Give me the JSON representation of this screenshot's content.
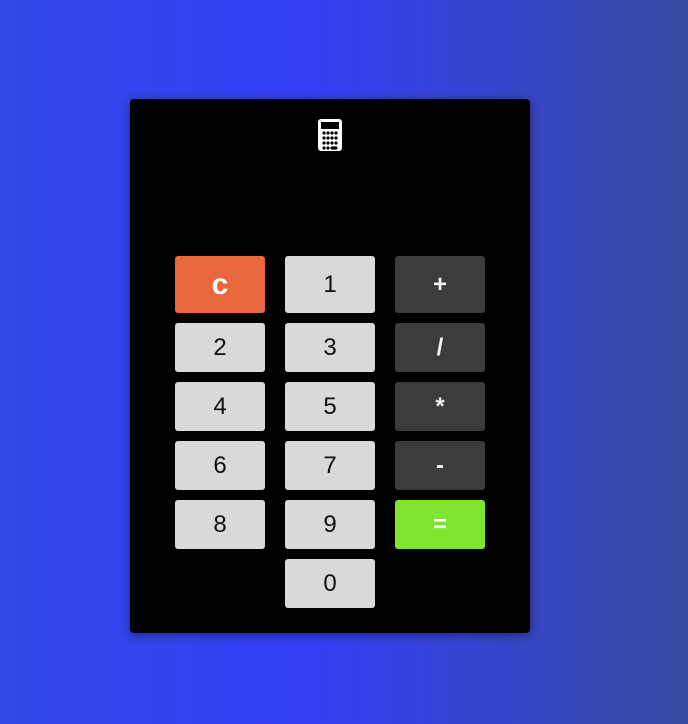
{
  "calculator": {
    "icon": "calculator-icon",
    "display_value": "",
    "buttons": {
      "clear": "c",
      "one": "1",
      "plus": "+",
      "two": "2",
      "three": "3",
      "divide": "/",
      "four": "4",
      "five": "5",
      "multiply": "*",
      "six": "6",
      "seven": "7",
      "minus": "-",
      "eight": "8",
      "nine": "9",
      "equals": "=",
      "zero": "0"
    },
    "colors": {
      "clear": "#e8673f",
      "equals": "#7ce52c",
      "operator": "#3c3c3c",
      "number": "#d9d9d9",
      "panel": "#000000"
    }
  }
}
